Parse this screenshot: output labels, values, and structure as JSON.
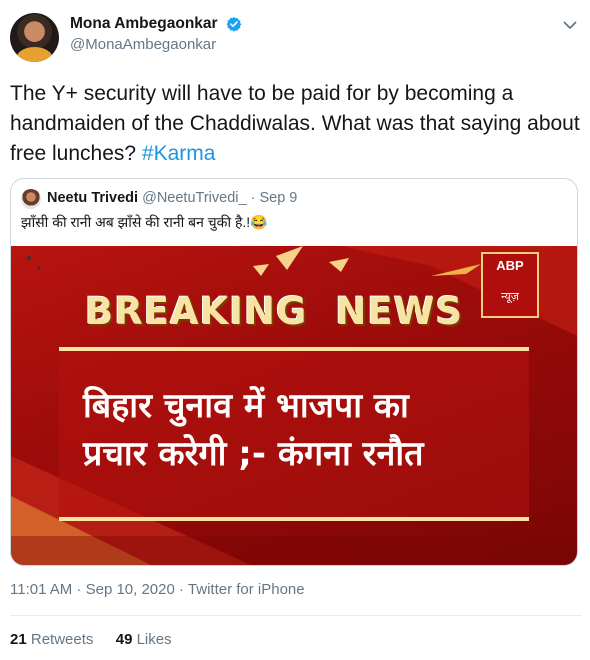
{
  "tweet": {
    "display_name": "Mona Ambegaonkar",
    "handle": "@MonaAmbegaonkar",
    "text": "The Y+ security will have to be paid for by becoming a handmaiden of the Chaddiwalas. What was that saying about free lunches? ",
    "hashtag": "#Karma",
    "timestamp": "11:01 AM · Sep 10, 2020 · Twitter for iPhone",
    "retweets_count": "21",
    "retweets_label": "Retweets",
    "likes_count": "49",
    "likes_label": "Likes"
  },
  "quoted_tweet": {
    "display_name": "Neetu Trivedi",
    "handle": "@NeetuTrivedi_",
    "separator": "·",
    "date": "Sep 9",
    "text": "झाँसी की रानी अब झाँसे की रानी बन चुकी है.!😂",
    "media": {
      "breaking_word": "BREAKING",
      "news_word": "NEWS",
      "logo_text": "ABP",
      "logo_subtext": "न्यूज़",
      "headline_line1": "बिहार चुनाव में भाजपा का",
      "headline_line2": "प्रचार करेगी ;- कंगना रनौत"
    }
  },
  "icons": {
    "verified": "verified-badge-icon",
    "chevron": "chevron-down-icon"
  },
  "colors": {
    "link": "#1b95e0",
    "verified": "#1da1f2",
    "secondary_text": "#657786",
    "media_red": "#9a0b09"
  }
}
